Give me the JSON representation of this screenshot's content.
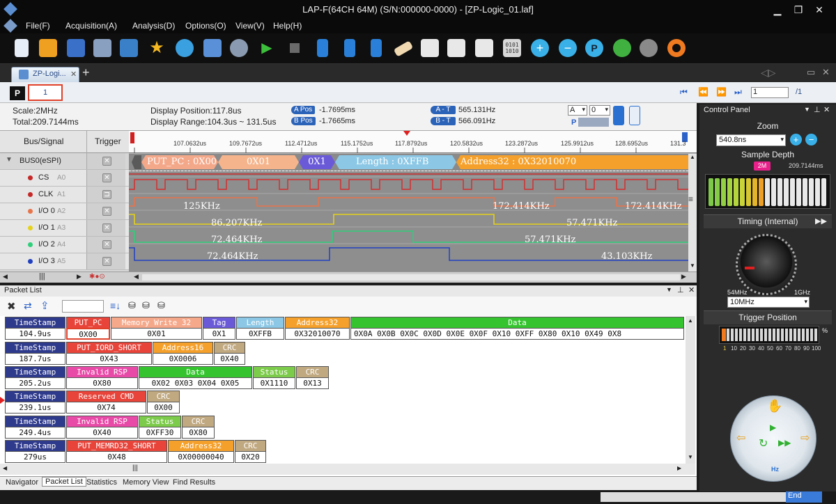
{
  "window": {
    "title": "LAP-F(64CH 64M) (S/N:000000-0000) - [ZP-Logic_01.laf]"
  },
  "menu": [
    "File(F)",
    "Acquisition(A)",
    "Analysis(D)",
    "Options(O)",
    "View(V)",
    "Help(H)"
  ],
  "doc_tab": "ZP-Logi...",
  "page": {
    "current": "1",
    "input": "1",
    "total": "/1",
    "mode": "P"
  },
  "info": {
    "scale": "Scale:2MHz",
    "total": "Total:209.7144ms",
    "display_position": "Display Position:117.8us",
    "display_range": "Display Range:104.3us ~ 131.5us",
    "a_pos_label": "A Pos",
    "a_pos": "-1.7695ms",
    "b_pos_label": "B Pos",
    "b_pos": "-1.7665ms",
    "a_t_label": "A - T",
    "a_t": "565.131Hz",
    "b_t_label": "B - T",
    "b_t": "566.091Hz",
    "sel_a": "A",
    "sel_0": "0",
    "sel_p": "P"
  },
  "signals": {
    "header_bus": "Bus/Signal",
    "header_trigger": "Trigger",
    "rows": [
      {
        "name": "BUS0(eSPI)",
        "ch": "",
        "color": ""
      },
      {
        "name": "CS",
        "ch": "A0",
        "color": "#c62828"
      },
      {
        "name": "CLK",
        "ch": "A1",
        "color": "#c62828"
      },
      {
        "name": "I/O 0",
        "ch": "A2",
        "color": "#e8744a"
      },
      {
        "name": "I/O 1",
        "ch": "A3",
        "color": "#e6d21a"
      },
      {
        "name": "I/O 2",
        "ch": "A4",
        "color": "#2ecf7a"
      },
      {
        "name": "I/O 3",
        "ch": "A5",
        "color": "#2040c0"
      }
    ]
  },
  "timeline_ticks": [
    "107.0632us",
    "109.7672us",
    "112.4712us",
    "115.1752us",
    "117.8792us",
    "120.5832us",
    "123.2872us",
    "125.9912us",
    "128.6952us",
    "131.3"
  ],
  "bus_segments": [
    {
      "label": "PUT_PC : 0X00",
      "color": "#f4a88a"
    },
    {
      "label": "0X01",
      "color": "#f5b48c"
    },
    {
      "label": "0X1",
      "color": "#6a5ad8"
    },
    {
      "label": "Length  : 0XFFB",
      "color": "#8cc8e6"
    },
    {
      "label": "Address32  : 0X32010070",
      "color": "#f5a02a"
    }
  ],
  "freq_labels": {
    "io0": [
      "125KHz",
      "172.414KHz",
      "172.414KHz"
    ],
    "io1": [
      "86.207KHz",
      "57.471KHz"
    ],
    "io2": [
      "72.464KHz",
      "57.471KHz"
    ],
    "io3": [
      "72.464KHz",
      "43.103KHz"
    ]
  },
  "packet_list": {
    "title": "Packet List",
    "rows": [
      {
        "cells": [
          {
            "h": "TimeStamp",
            "v": "104.9us",
            "c": "#2e3a8c"
          },
          {
            "h": "PUT_PC",
            "v": "0X00",
            "c": "#e8443a"
          },
          {
            "h": "Memory Write 32",
            "v": "0X01",
            "c": "#f5a88a"
          },
          {
            "h": "Tag",
            "v": "0X1",
            "c": "#6a5ad8"
          },
          {
            "h": "Length",
            "v": "0XFFB",
            "c": "#8cc8e6"
          },
          {
            "h": "Address32",
            "v": "0X32010070",
            "c": "#f5a02a"
          },
          {
            "h": "Data",
            "v": "0X0A  0X0B  0X0C  0X0D  0X0E  0X0F  0X10  0XFF  0X80  0X10  0X49  0X8",
            "c": "#35c430"
          }
        ]
      },
      {
        "cells": [
          {
            "h": "TimeStamp",
            "v": "187.7us",
            "c": "#2e3a8c"
          },
          {
            "h": "PUT_IORD_SHORT",
            "v": "0X43",
            "c": "#e8443a"
          },
          {
            "h": "Address16",
            "v": "0X0006",
            "c": "#f5a02a"
          },
          {
            "h": "CRC",
            "v": "0X40",
            "c": "#c0a880"
          }
        ]
      },
      {
        "cells": [
          {
            "h": "TimeStamp",
            "v": "205.2us",
            "c": "#2e3a8c"
          },
          {
            "h": "Invalid RSP",
            "v": "0X80",
            "c": "#e84aa8"
          },
          {
            "h": "Data",
            "v": "0X02  0X03  0X04  0X05",
            "c": "#35c430"
          },
          {
            "h": "Status",
            "v": "0X1110",
            "c": "#7ccb4a"
          },
          {
            "h": "CRC",
            "v": "0X13",
            "c": "#c0a880"
          }
        ]
      },
      {
        "cells": [
          {
            "h": "TimeStamp",
            "v": "239.1us",
            "c": "#2e3a8c"
          },
          {
            "h": "Reserved CMD",
            "v": "0X74",
            "c": "#e8443a"
          },
          {
            "h": "CRC",
            "v": "0X00",
            "c": "#c0a880"
          }
        ]
      },
      {
        "cells": [
          {
            "h": "TimeStamp",
            "v": "249.4us",
            "c": "#2e3a8c"
          },
          {
            "h": "Invalid RSP",
            "v": "0X40",
            "c": "#e84aa8"
          },
          {
            "h": "Status",
            "v": "0XFF30",
            "c": "#7ccb4a"
          },
          {
            "h": "CRC",
            "v": "0X80",
            "c": "#c0a880"
          }
        ]
      },
      {
        "cells": [
          {
            "h": "TimeStamp",
            "v": "279us",
            "c": "#2e3a8c"
          },
          {
            "h": "PUT_MEMRD32_SHORT",
            "v": "0X48",
            "c": "#e8443a"
          },
          {
            "h": "Address32",
            "v": "0X00000040",
            "c": "#f5a02a"
          },
          {
            "h": "CRC",
            "v": "0X20",
            "c": "#c0a880"
          }
        ]
      }
    ]
  },
  "bottom_tabs": [
    "Navigator",
    "Packet List",
    "Statistics",
    "Memory View",
    "Find Results"
  ],
  "control_panel": {
    "title": "Control Panel",
    "zoom_label": "Zoom",
    "zoom_value": "540.8ns",
    "sample_depth_label": "Sample Depth",
    "sample_depth_marker": "2M",
    "sample_depth_total": "209.7144ms",
    "timing_label": "Timing (Internal)",
    "timing_min": "54MHz",
    "timing_max": "1GHz",
    "timing_value": "10MHz",
    "trigger_position_label": "Trigger Position",
    "trigger_percent": "%",
    "trigger_ticks": [
      "1",
      "10",
      "20",
      "30",
      "40",
      "50",
      "60",
      "70",
      "80",
      "90",
      "100"
    ],
    "hz": "Hz"
  },
  "status": {
    "end": "End"
  },
  "colors": {
    "accent": "#2b63b8",
    "wave_bg": "#b9b9b9"
  }
}
